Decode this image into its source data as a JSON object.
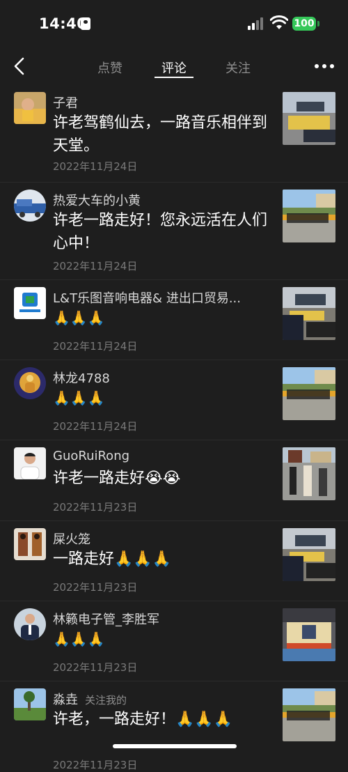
{
  "status": {
    "time": "14:40",
    "battery": "100"
  },
  "nav": {
    "tabs": [
      {
        "label": "点赞",
        "active": false
      },
      {
        "label": "评论",
        "active": true
      },
      {
        "label": "关注",
        "active": false
      }
    ]
  },
  "comments": [
    {
      "user": "子君",
      "text": "许老驾鹤仙去，一路音乐相伴到天堂。",
      "date": "2022年11月24日"
    },
    {
      "user": "热爱大车的小黄",
      "text": "许老一路走好！您永远活在人们心中！",
      "date": "2022年11月24日"
    },
    {
      "user": "L&T乐图音响电器& 进出口贸易...",
      "text": "🙏🙏🙏",
      "date": "2022年11月24日"
    },
    {
      "user": "林龙4788",
      "text": "🙏🙏🙏",
      "date": "2022年11月24日"
    },
    {
      "user": "GuoRuiRong",
      "text": "许老一路走好😭😭",
      "date": "2022年11月23日"
    },
    {
      "user": "屎火笼",
      "text": "一路走好🙏🙏🙏",
      "date": "2022年11月23日"
    },
    {
      "user": "林籁电子管_李胜军",
      "text": "🙏🙏🙏",
      "date": "2022年11月23日"
    },
    {
      "user": "淼垚",
      "tag": "关注我的",
      "text": "许老，一路走好！🙏🙏🙏",
      "date": "2022年11月23日"
    }
  ]
}
